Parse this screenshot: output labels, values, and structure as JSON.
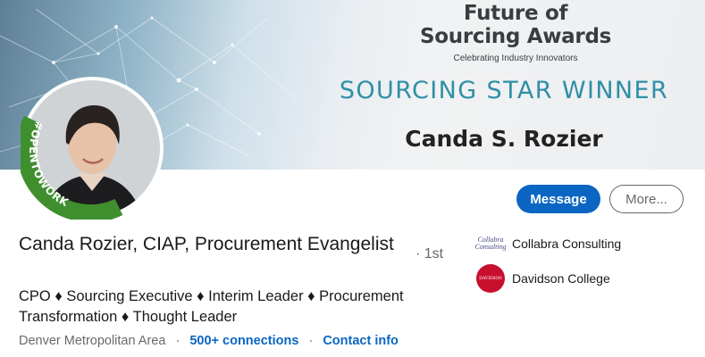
{
  "banner": {
    "title_line1": "Future of",
    "title_line2": "Sourcing Awards",
    "tagline": "Celebrating Industry Innovators",
    "award": "SOURCING STAR WINNER",
    "winner": "Canda S. Rozier"
  },
  "avatar": {
    "badge": "#OPENTOWORK",
    "badge_color": "#3f8f2e"
  },
  "actions": {
    "message_label": "Message",
    "more_label": "More..."
  },
  "profile": {
    "name": "Canda Rozier, CIAP, Procurement Evangelist",
    "degree": "· 1st",
    "headline": "CPO ♦ Sourcing Executive ♦ Interim Leader ♦ Procurement Transformation ♦ Thought Leader",
    "location": "Denver Metropolitan Area",
    "separator": "·",
    "connections": "500+ connections",
    "contact": "Contact info"
  },
  "organizations": [
    {
      "name": "Collabra Consulting",
      "logo_text": "Collabra Consulting",
      "icon": "collabra-logo"
    },
    {
      "name": "Davidson College",
      "logo_text": "DAVIDSON",
      "icon": "davidson-logo"
    }
  ],
  "colors": {
    "primary": "#0a66c2",
    "award_teal": "#2f8fa6"
  }
}
